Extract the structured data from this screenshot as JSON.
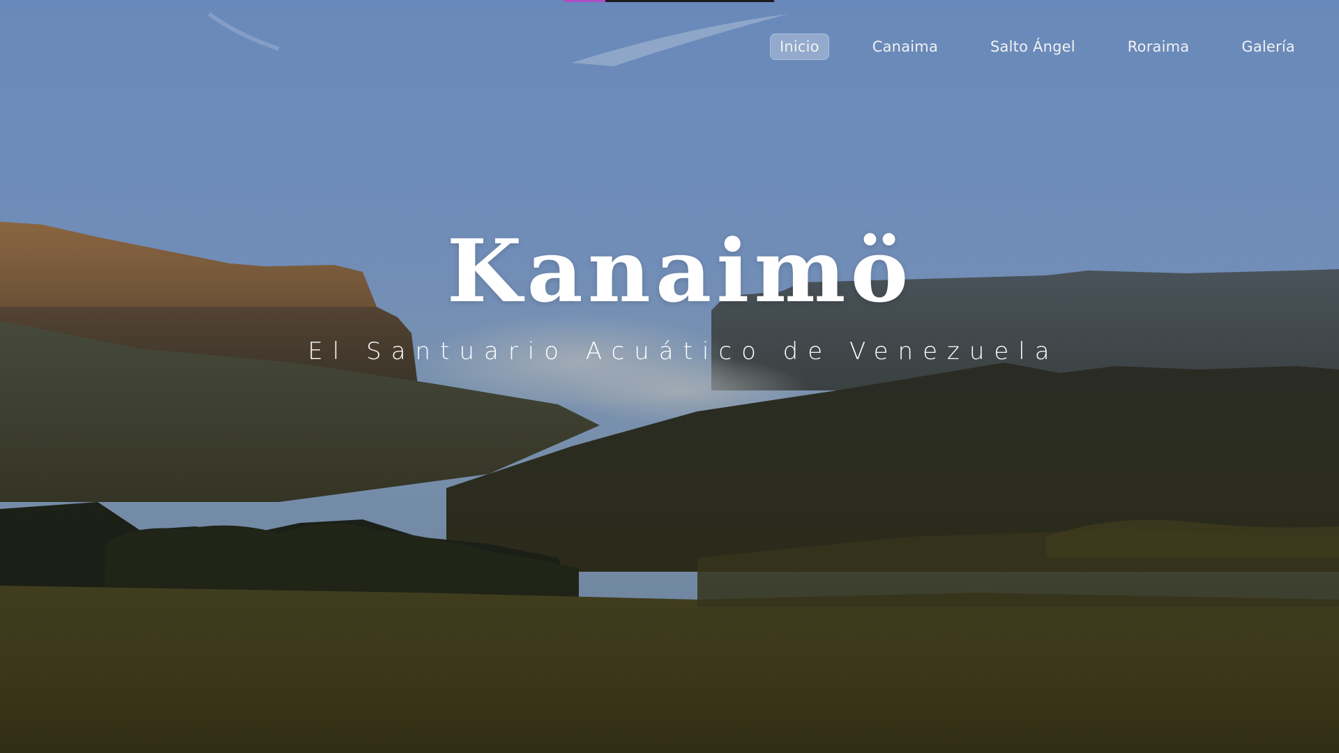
{
  "nav": {
    "items": [
      {
        "label": "Inicio",
        "active": true
      },
      {
        "label": "Canaima",
        "active": false
      },
      {
        "label": "Salto Ángel",
        "active": false
      },
      {
        "label": "Roraima",
        "active": false
      },
      {
        "label": "Galería",
        "active": false
      }
    ]
  },
  "hero": {
    "title": "Kanaimö",
    "subtitle": "El Santuario Acuático de Venezuela",
    "background": "landscape-photo-tepuis"
  },
  "scroll_progress": {
    "value": 0.2,
    "color": "#b04fc5"
  },
  "colors": {
    "sky": "#6f93c7",
    "text": "#ffffff"
  }
}
